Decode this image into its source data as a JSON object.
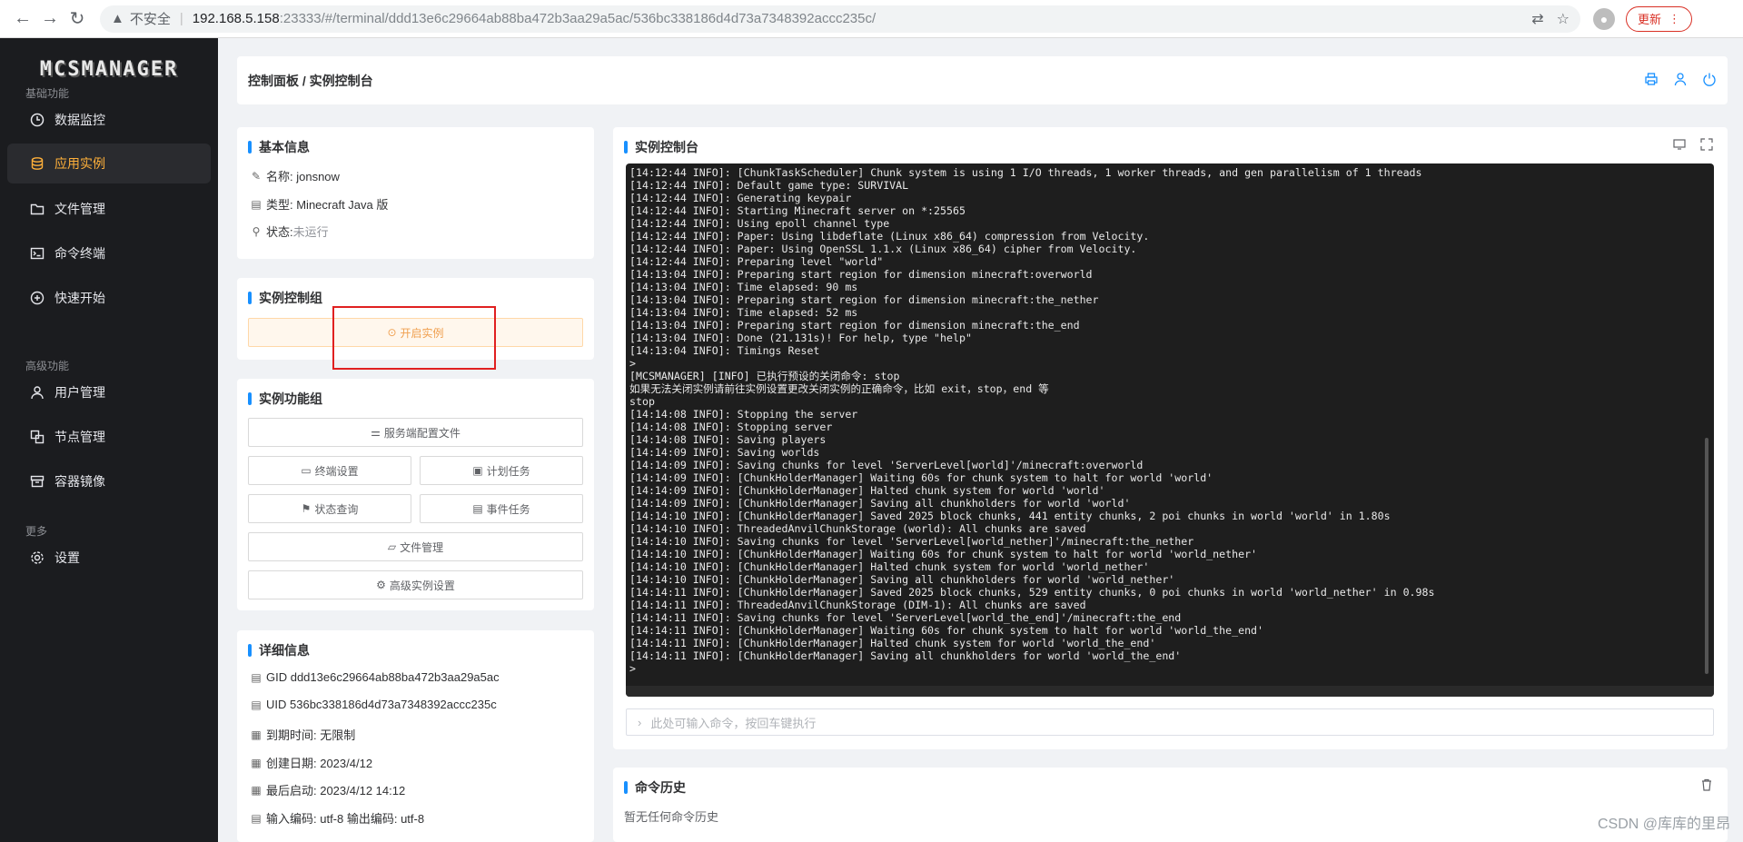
{
  "browser": {
    "insecure_label": "不安全",
    "url_host": "192.168.5.158",
    "url_path": ":23333/#/terminal/ddd13e6c29664ab88ba472b3aa29a5ac/536bc338186d4d73a7348392accc235c/",
    "update_label": "更新"
  },
  "sidebar": {
    "logo": "MCSMANAGER",
    "sections": [
      "基础功能",
      "高级功能",
      "更多"
    ],
    "items": [
      {
        "label": "数据监控",
        "icon": "dashboard-icon"
      },
      {
        "label": "应用实例",
        "icon": "database-icon"
      },
      {
        "label": "文件管理",
        "icon": "folder-icon"
      },
      {
        "label": "命令终端",
        "icon": "terminal-icon"
      },
      {
        "label": "快速开始",
        "icon": "plus-circle-icon"
      },
      {
        "label": "用户管理",
        "icon": "user-icon"
      },
      {
        "label": "节点管理",
        "icon": "node-icon"
      },
      {
        "label": "容器镜像",
        "icon": "box-icon"
      },
      {
        "label": "设置",
        "icon": "gear-icon"
      }
    ]
  },
  "header": {
    "breadcrumb": "控制面板 / 实例控制台"
  },
  "basic_info": {
    "title": "基本信息",
    "name": "名称: jonsnow",
    "type": "类型: Minecraft Java 版",
    "status_label": "状态: ",
    "status_value": "未运行"
  },
  "control_group": {
    "title": "实例控制组",
    "start_label": "开启实例"
  },
  "function_group": {
    "title": "实例功能组",
    "server_config": "服务端配置文件",
    "terminal_settings": "终端设置",
    "scheduled_tasks": "计划任务",
    "status_query": "状态查询",
    "event_tasks": "事件任务",
    "file_manage": "文件管理",
    "advanced_settings": "高级实例设置"
  },
  "details": {
    "title": "详细信息",
    "gid": "GID ddd13e6c29664ab88ba472b3aa29a5ac",
    "uid": "UID 536bc338186d4d73a7348392accc235c",
    "expire": "到期时间: 无限制",
    "created": "创建日期: 2023/4/12",
    "last_start": "最后启动: 2023/4/12 14:12",
    "encoding": "输入编码: utf-8 输出编码: utf-8"
  },
  "console": {
    "title": "实例控制台",
    "lines": [
      "[14:12:44 INFO]: [ChunkTaskScheduler] Chunk system is using 1 I/O threads, 1 worker threads, and gen parallelism of 1 threads",
      "[14:12:44 INFO]: Default game type: SURVIVAL",
      "[14:12:44 INFO]: Generating keypair",
      "[14:12:44 INFO]: Starting Minecraft server on *:25565",
      "[14:12:44 INFO]: Using epoll channel type",
      "[14:12:44 INFO]: Paper: Using libdeflate (Linux x86_64) compression from Velocity.",
      "[14:12:44 INFO]: Paper: Using OpenSSL 1.1.x (Linux x86_64) cipher from Velocity.",
      "[14:12:44 INFO]: Preparing level \"world\"",
      "[14:13:04 INFO]: Preparing start region for dimension minecraft:overworld",
      "[14:13:04 INFO]: Time elapsed: 90 ms",
      "[14:13:04 INFO]: Preparing start region for dimension minecraft:the_nether",
      "[14:13:04 INFO]: Time elapsed: 52 ms",
      "[14:13:04 INFO]: Preparing start region for dimension minecraft:the_end",
      "[14:13:04 INFO]: Done (21.131s)! For help, type \"help\"",
      "[14:13:04 INFO]: Timings Reset",
      ">",
      "[MCSMANAGER] [INFO] 已执行预设的关闭命令: stop",
      "如果无法关闭实例请前往实例设置更改关闭实例的正确命令，比如 exit，stop，end 等",
      "stop",
      "[14:14:08 INFO]: Stopping the server",
      "[14:14:08 INFO]: Stopping server",
      "[14:14:08 INFO]: Saving players",
      "[14:14:09 INFO]: Saving worlds",
      "[14:14:09 INFO]: Saving chunks for level 'ServerLevel[world]'/minecraft:overworld",
      "[14:14:09 INFO]: [ChunkHolderManager] Waiting 60s for chunk system to halt for world 'world'",
      "[14:14:09 INFO]: [ChunkHolderManager] Halted chunk system for world 'world'",
      "[14:14:09 INFO]: [ChunkHolderManager] Saving all chunkholders for world 'world'",
      "[14:14:10 INFO]: [ChunkHolderManager] Saved 2025 block chunks, 441 entity chunks, 2 poi chunks in world 'world' in 1.80s",
      "[14:14:10 INFO]: ThreadedAnvilChunkStorage (world): All chunks are saved",
      "[14:14:10 INFO]: Saving chunks for level 'ServerLevel[world_nether]'/minecraft:the_nether",
      "[14:14:10 INFO]: [ChunkHolderManager] Waiting 60s for chunk system to halt for world 'world_nether'",
      "[14:14:10 INFO]: [ChunkHolderManager] Halted chunk system for world 'world_nether'",
      "[14:14:10 INFO]: [ChunkHolderManager] Saving all chunkholders for world 'world_nether'",
      "[14:14:11 INFO]: [ChunkHolderManager] Saved 2025 block chunks, 529 entity chunks, 0 poi chunks in world 'world_nether' in 0.98s",
      "[14:14:11 INFO]: ThreadedAnvilChunkStorage (DIM-1): All chunks are saved",
      "[14:14:11 INFO]: Saving chunks for level 'ServerLevel[world_the_end]'/minecraft:the_end",
      "[14:14:11 INFO]: [ChunkHolderManager] Waiting 60s for chunk system to halt for world 'world_the_end'",
      "[14:14:11 INFO]: [ChunkHolderManager] Halted chunk system for world 'world_the_end'",
      "[14:14:11 INFO]: [ChunkHolderManager] Saving all chunkholders for world 'world_the_end'",
      ">"
    ],
    "input_placeholder": "此处可输入命令，按回车键执行"
  },
  "history": {
    "title": "命令历史",
    "empty": "暂无任何命令历史"
  },
  "watermark": "CSDN @库库的里昂",
  "colors": {
    "accent": "#1890ff",
    "sidebar_bg": "#1b1c1f",
    "active_item": "#ffb03a",
    "highlight_box": "#e02020"
  }
}
